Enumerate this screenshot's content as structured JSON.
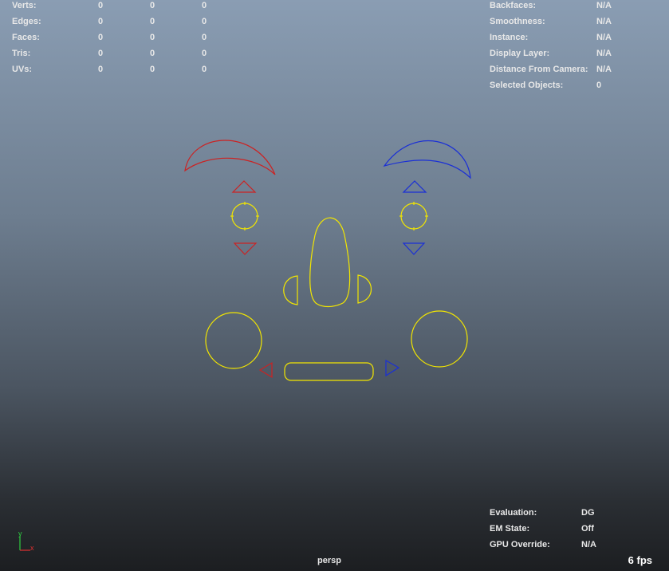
{
  "stats": {
    "rows": [
      {
        "label": "Verts:",
        "v1": "0",
        "v2": "0",
        "v3": "0"
      },
      {
        "label": "Edges:",
        "v1": "0",
        "v2": "0",
        "v3": "0"
      },
      {
        "label": "Faces:",
        "v1": "0",
        "v2": "0",
        "v3": "0"
      },
      {
        "label": "Tris:",
        "v1": "0",
        "v2": "0",
        "v3": "0"
      },
      {
        "label": "UVs:",
        "v1": "0",
        "v2": "0",
        "v3": "0"
      }
    ]
  },
  "info": {
    "rows": [
      {
        "label": "Backfaces:",
        "value": "N/A"
      },
      {
        "label": "Smoothness:",
        "value": "N/A"
      },
      {
        "label": "Instance:",
        "value": "N/A"
      },
      {
        "label": "Display Layer:",
        "value": "N/A"
      },
      {
        "label": "Distance From Camera:",
        "value": "N/A"
      },
      {
        "label": "Selected Objects:",
        "value": "0"
      }
    ]
  },
  "perf": {
    "rows": [
      {
        "label": "Evaluation:",
        "value": "DG"
      },
      {
        "label": "EM State:",
        "value": "Off"
      },
      {
        "label": "GPU Override:",
        "value": "N/A"
      }
    ]
  },
  "camera": "persp",
  "fps": "6 fps",
  "axis": {
    "y": "y",
    "x": "x",
    "y_color": "#2ecc40",
    "x_color": "#e03030"
  },
  "colors": {
    "left_side": "#cc2222",
    "right_side": "#1a2fd6",
    "center": "#f2e600"
  },
  "icons": [
    "axis-gizmo-icon"
  ]
}
